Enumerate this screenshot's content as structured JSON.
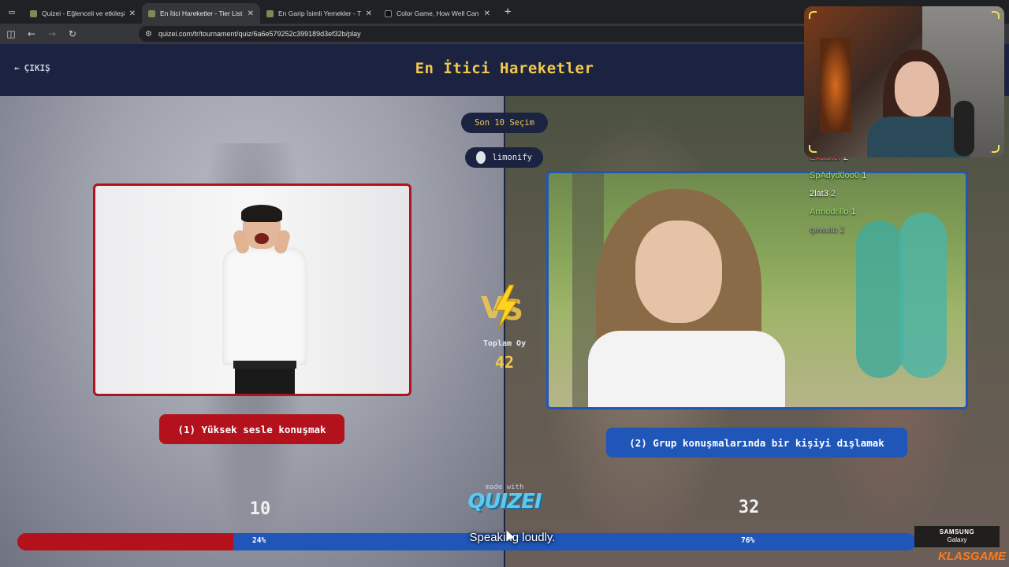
{
  "browser": {
    "tabs": [
      {
        "title": "Quizei - Eğlenceli ve etkileşimli",
        "active": false
      },
      {
        "title": "En İtici Hareketler - Tier List, Kö",
        "active": true
      },
      {
        "title": "En Garip İsimli Yemekler - Tier L",
        "active": false
      },
      {
        "title": "Color Game, How Well Can You",
        "active": false
      }
    ],
    "close_glyph": "✕",
    "new_tab_glyph": "+",
    "url": "quizei.com/tr/tournament/quiz/6a6e579252c399189d3ef32b/play"
  },
  "header": {
    "exit_label": "ÇIKIŞ",
    "title": "En İtici Hareketler"
  },
  "badges": {
    "recent": "Son 10 Seçim",
    "user": "limonify"
  },
  "options": {
    "left": {
      "label": "(1) Yüksek sesle konuşmak",
      "votes": "10",
      "percent": "24%",
      "fraction": 0.24
    },
    "right": {
      "label": "(2) Grup konuşmalarında bir kişiyi dışlamak",
      "votes": "32",
      "percent": "76%"
    }
  },
  "center": {
    "total_label": "Toplam Oy",
    "total_value": "42",
    "made_with": "made with",
    "brand": "QUIZEI"
  },
  "chat": [
    {
      "user": "Excalter",
      "count": "2",
      "color": "#ff4d4d"
    },
    {
      "user": "SpAdyd0oo0",
      "count": "1",
      "color": "#9be86b"
    },
    {
      "user": "2lat3",
      "count": "2",
      "color": "#ffffff"
    },
    {
      "user": "Armodrillo",
      "count": "1",
      "color": "#9be86b"
    },
    {
      "user": "qewuto",
      "count": "2",
      "color": "#9a9a9a"
    }
  ],
  "subtitle": "Speaking loudly.",
  "overlay": {
    "samsung_brand": "SAMSUNG",
    "samsung_product": "Galaxy",
    "sponsor": "KLASGAME"
  },
  "colors": {
    "accent_yellow": "#f2c94c",
    "left_red": "#b3121d",
    "right_blue": "#1f56b8",
    "header_bg": "#1b2340"
  },
  "icons": {
    "tab_menu": "tab-search-icon",
    "back": "back-arrow-icon",
    "forward": "forward-arrow-icon",
    "reload": "reload-icon",
    "site_info": "site-info-icon",
    "exit": "arrow-left-icon",
    "vs": "vs-lightning-icon"
  }
}
